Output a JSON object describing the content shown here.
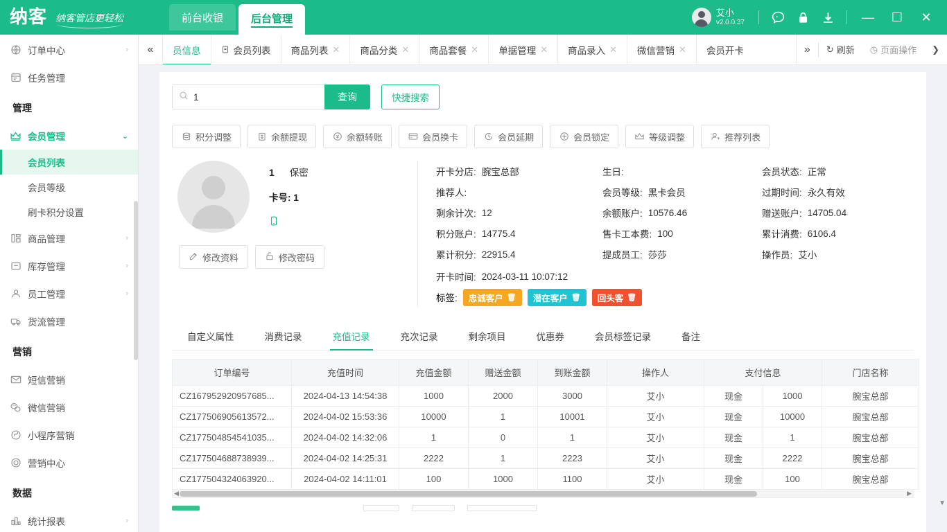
{
  "header": {
    "logo_text": "纳客",
    "slogan": "纳客管店更轻松",
    "nav": [
      {
        "label": "前台收银",
        "active": false
      },
      {
        "label": "后台管理",
        "active": true
      }
    ],
    "user": {
      "name": "艾小",
      "version": "v2.0.0.37"
    },
    "icons": [
      {
        "name": "chat-icon",
        "glyph": "💬"
      },
      {
        "name": "lock-icon",
        "glyph": "🔒"
      },
      {
        "name": "download-icon",
        "glyph": "⬇"
      }
    ],
    "window": {
      "minimize": "—",
      "maximize": "☐",
      "close": "✕"
    }
  },
  "sidebar": {
    "items": [
      {
        "label": "订单中心",
        "icon": "globe-icon",
        "arrow": "›",
        "type": "item"
      },
      {
        "label": "任务管理",
        "icon": "task-icon",
        "arrow": "",
        "type": "item"
      },
      {
        "label": "管理",
        "type": "group"
      },
      {
        "label": "会员管理",
        "icon": "crown-icon",
        "arrow": "⌄",
        "type": "item",
        "active": true
      },
      {
        "label": "会员列表",
        "type": "sub",
        "active": true
      },
      {
        "label": "会员等级",
        "type": "sub"
      },
      {
        "label": "刷卡积分设置",
        "type": "sub"
      },
      {
        "label": "商品管理",
        "icon": "goods-icon",
        "arrow": "›",
        "type": "item"
      },
      {
        "label": "库存管理",
        "icon": "box-icon",
        "arrow": "›",
        "type": "item"
      },
      {
        "label": "员工管理",
        "icon": "user-icon",
        "arrow": "›",
        "type": "item"
      },
      {
        "label": "货流管理",
        "icon": "truck-icon",
        "arrow": "",
        "type": "item"
      },
      {
        "label": "营销",
        "type": "group"
      },
      {
        "label": "短信营销",
        "icon": "mail-icon",
        "arrow": "",
        "type": "item"
      },
      {
        "label": "微信营销",
        "icon": "wechat-icon",
        "arrow": "",
        "type": "item"
      },
      {
        "label": "小程序营销",
        "icon": "miniprogram-icon",
        "arrow": "",
        "type": "item"
      },
      {
        "label": "营销中心",
        "icon": "target-icon",
        "arrow": "",
        "type": "item"
      },
      {
        "label": "数据",
        "type": "group"
      },
      {
        "label": "统计报表",
        "icon": "chart-icon",
        "arrow": "›",
        "type": "item"
      }
    ]
  },
  "tabbar": {
    "collapse_icon": "«",
    "tabs": [
      {
        "label": "员信息",
        "icon": "",
        "closable": false,
        "active": true
      },
      {
        "label": "会员列表",
        "icon": "clipboard-icon",
        "closable": false
      },
      {
        "label": "商品列表",
        "icon": "",
        "closable": true
      },
      {
        "label": "商品分类",
        "icon": "",
        "closable": true
      },
      {
        "label": "商品套餐",
        "icon": "",
        "closable": true
      },
      {
        "label": "单据管理",
        "icon": "",
        "closable": true
      },
      {
        "label": "商品录入",
        "icon": "",
        "closable": true
      },
      {
        "label": "微信营销",
        "icon": "",
        "closable": true
      },
      {
        "label": "会员开卡",
        "icon": "",
        "closable": true
      }
    ],
    "more_icon": "»",
    "refresh_label": "刷新",
    "refresh_icon": "↻",
    "page_ops_label": "页面操作",
    "page_ops_icon": "◷",
    "page_ops_arrow": "❯"
  },
  "search": {
    "value": "1",
    "placeholder": "",
    "icon": "search-icon",
    "query_label": "查询",
    "quick_label": "快捷搜索"
  },
  "actions": [
    {
      "label": "积分调整",
      "icon": "coins-icon"
    },
    {
      "label": "余额提现",
      "icon": "withdraw-icon"
    },
    {
      "label": "余额转账",
      "icon": "transfer-icon"
    },
    {
      "label": "会员换卡",
      "icon": "card-icon"
    },
    {
      "label": "会员延期",
      "icon": "clock-icon"
    },
    {
      "label": "会员锁定",
      "icon": "lock-circle-icon"
    },
    {
      "label": "等级调整",
      "icon": "crown-icon"
    },
    {
      "label": "推荐列表",
      "icon": "person-add-icon"
    }
  ],
  "member": {
    "name": "1",
    "gender": "保密",
    "card_label": "卡号:",
    "card_value": "1",
    "phone_icon": "phone-icon",
    "edit_profile_label": "修改资料",
    "edit_password_label": "修改密码",
    "col1": [
      {
        "key": "开卡分店:",
        "value": "腕宝总部"
      },
      {
        "key": "推荐人:",
        "value": ""
      },
      {
        "key": "剩余计次:",
        "value": "12"
      },
      {
        "key": "积分账户:",
        "value": "14775.4"
      },
      {
        "key": "累计积分:",
        "value": "22915.4"
      }
    ],
    "col2": [
      {
        "key": "生日:",
        "value": ""
      },
      {
        "key": "会员等级:",
        "value": "黑卡会员"
      },
      {
        "key": "余额账户:",
        "value": "10576.46"
      },
      {
        "key": "售卡工本费:",
        "value": "100"
      },
      {
        "key": "提成员工:",
        "value": "莎莎"
      }
    ],
    "col3": [
      {
        "key": "会员状态:",
        "value": "正常"
      },
      {
        "key": "过期时间:",
        "value": "永久有效"
      },
      {
        "key": "赠送账户:",
        "value": "14705.04"
      },
      {
        "key": "累计消费:",
        "value": "6106.4"
      },
      {
        "key": "操作员:",
        "value": "艾小"
      }
    ],
    "open_time": {
      "key": "开卡时间:",
      "value": "2024-03-11 10:07:12"
    },
    "tags_label": "标签:",
    "tags": [
      {
        "label": "忠诚客户",
        "color": "#f5a623"
      },
      {
        "label": "潜在客户",
        "color": "#1fc3d1"
      },
      {
        "label": "回头客",
        "color": "#f0522f"
      }
    ],
    "tag_delete_icon": "🗑"
  },
  "subtabs": [
    {
      "label": "自定义属性"
    },
    {
      "label": "消费记录"
    },
    {
      "label": "充值记录",
      "active": true
    },
    {
      "label": "充次记录"
    },
    {
      "label": "剩余项目"
    },
    {
      "label": "优惠券"
    },
    {
      "label": "会员标签记录"
    },
    {
      "label": "备注"
    }
  ],
  "table": {
    "columns": [
      "订单编号",
      "充值时间",
      "充值金额",
      "赠送金额",
      "到账金额",
      "操作人",
      "支付信息",
      "",
      "门店名称"
    ],
    "rows": [
      [
        "CZ167952920957685...",
        "2024-04-13 14:54:38",
        "1000",
        "2000",
        "3000",
        "艾小",
        "现金",
        "1000",
        "腕宝总部"
      ],
      [
        "CZ177506905613572...",
        "2024-04-02 15:53:36",
        "10000",
        "1",
        "10001",
        "艾小",
        "现金",
        "10000",
        "腕宝总部"
      ],
      [
        "CZ177504854541035...",
        "2024-04-02 14:32:06",
        "1",
        "0",
        "1",
        "艾小",
        "现金",
        "1",
        "腕宝总部"
      ],
      [
        "CZ177504688738939...",
        "2024-04-02 14:25:31",
        "2222",
        "1",
        "2223",
        "艾小",
        "现金",
        "2222",
        "腕宝总部"
      ],
      [
        "CZ177504324063920...",
        "2024-04-02 14:11:01",
        "100",
        "1000",
        "1100",
        "艾小",
        "现金",
        "100",
        "腕宝总部"
      ]
    ]
  }
}
